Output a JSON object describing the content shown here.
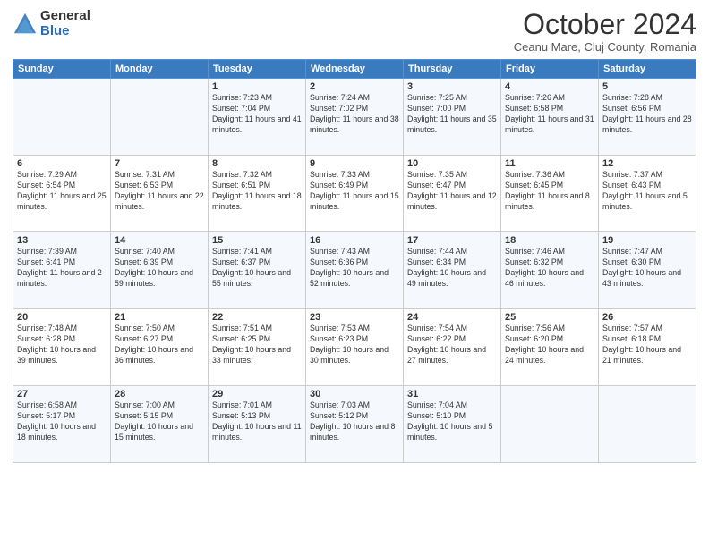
{
  "header": {
    "logo_general": "General",
    "logo_blue": "Blue",
    "month_title": "October 2024",
    "subtitle": "Ceanu Mare, Cluj County, Romania"
  },
  "days_of_week": [
    "Sunday",
    "Monday",
    "Tuesday",
    "Wednesday",
    "Thursday",
    "Friday",
    "Saturday"
  ],
  "weeks": [
    [
      {
        "day": "",
        "info": ""
      },
      {
        "day": "",
        "info": ""
      },
      {
        "day": "1",
        "info": "Sunrise: 7:23 AM\nSunset: 7:04 PM\nDaylight: 11 hours and 41 minutes."
      },
      {
        "day": "2",
        "info": "Sunrise: 7:24 AM\nSunset: 7:02 PM\nDaylight: 11 hours and 38 minutes."
      },
      {
        "day": "3",
        "info": "Sunrise: 7:25 AM\nSunset: 7:00 PM\nDaylight: 11 hours and 35 minutes."
      },
      {
        "day": "4",
        "info": "Sunrise: 7:26 AM\nSunset: 6:58 PM\nDaylight: 11 hours and 31 minutes."
      },
      {
        "day": "5",
        "info": "Sunrise: 7:28 AM\nSunset: 6:56 PM\nDaylight: 11 hours and 28 minutes."
      }
    ],
    [
      {
        "day": "6",
        "info": "Sunrise: 7:29 AM\nSunset: 6:54 PM\nDaylight: 11 hours and 25 minutes."
      },
      {
        "day": "7",
        "info": "Sunrise: 7:31 AM\nSunset: 6:53 PM\nDaylight: 11 hours and 22 minutes."
      },
      {
        "day": "8",
        "info": "Sunrise: 7:32 AM\nSunset: 6:51 PM\nDaylight: 11 hours and 18 minutes."
      },
      {
        "day": "9",
        "info": "Sunrise: 7:33 AM\nSunset: 6:49 PM\nDaylight: 11 hours and 15 minutes."
      },
      {
        "day": "10",
        "info": "Sunrise: 7:35 AM\nSunset: 6:47 PM\nDaylight: 11 hours and 12 minutes."
      },
      {
        "day": "11",
        "info": "Sunrise: 7:36 AM\nSunset: 6:45 PM\nDaylight: 11 hours and 8 minutes."
      },
      {
        "day": "12",
        "info": "Sunrise: 7:37 AM\nSunset: 6:43 PM\nDaylight: 11 hours and 5 minutes."
      }
    ],
    [
      {
        "day": "13",
        "info": "Sunrise: 7:39 AM\nSunset: 6:41 PM\nDaylight: 11 hours and 2 minutes."
      },
      {
        "day": "14",
        "info": "Sunrise: 7:40 AM\nSunset: 6:39 PM\nDaylight: 10 hours and 59 minutes."
      },
      {
        "day": "15",
        "info": "Sunrise: 7:41 AM\nSunset: 6:37 PM\nDaylight: 10 hours and 55 minutes."
      },
      {
        "day": "16",
        "info": "Sunrise: 7:43 AM\nSunset: 6:36 PM\nDaylight: 10 hours and 52 minutes."
      },
      {
        "day": "17",
        "info": "Sunrise: 7:44 AM\nSunset: 6:34 PM\nDaylight: 10 hours and 49 minutes."
      },
      {
        "day": "18",
        "info": "Sunrise: 7:46 AM\nSunset: 6:32 PM\nDaylight: 10 hours and 46 minutes."
      },
      {
        "day": "19",
        "info": "Sunrise: 7:47 AM\nSunset: 6:30 PM\nDaylight: 10 hours and 43 minutes."
      }
    ],
    [
      {
        "day": "20",
        "info": "Sunrise: 7:48 AM\nSunset: 6:28 PM\nDaylight: 10 hours and 39 minutes."
      },
      {
        "day": "21",
        "info": "Sunrise: 7:50 AM\nSunset: 6:27 PM\nDaylight: 10 hours and 36 minutes."
      },
      {
        "day": "22",
        "info": "Sunrise: 7:51 AM\nSunset: 6:25 PM\nDaylight: 10 hours and 33 minutes."
      },
      {
        "day": "23",
        "info": "Sunrise: 7:53 AM\nSunset: 6:23 PM\nDaylight: 10 hours and 30 minutes."
      },
      {
        "day": "24",
        "info": "Sunrise: 7:54 AM\nSunset: 6:22 PM\nDaylight: 10 hours and 27 minutes."
      },
      {
        "day": "25",
        "info": "Sunrise: 7:56 AM\nSunset: 6:20 PM\nDaylight: 10 hours and 24 minutes."
      },
      {
        "day": "26",
        "info": "Sunrise: 7:57 AM\nSunset: 6:18 PM\nDaylight: 10 hours and 21 minutes."
      }
    ],
    [
      {
        "day": "27",
        "info": "Sunrise: 6:58 AM\nSunset: 5:17 PM\nDaylight: 10 hours and 18 minutes."
      },
      {
        "day": "28",
        "info": "Sunrise: 7:00 AM\nSunset: 5:15 PM\nDaylight: 10 hours and 15 minutes."
      },
      {
        "day": "29",
        "info": "Sunrise: 7:01 AM\nSunset: 5:13 PM\nDaylight: 10 hours and 11 minutes."
      },
      {
        "day": "30",
        "info": "Sunrise: 7:03 AM\nSunset: 5:12 PM\nDaylight: 10 hours and 8 minutes."
      },
      {
        "day": "31",
        "info": "Sunrise: 7:04 AM\nSunset: 5:10 PM\nDaylight: 10 hours and 5 minutes."
      },
      {
        "day": "",
        "info": ""
      },
      {
        "day": "",
        "info": ""
      }
    ]
  ]
}
